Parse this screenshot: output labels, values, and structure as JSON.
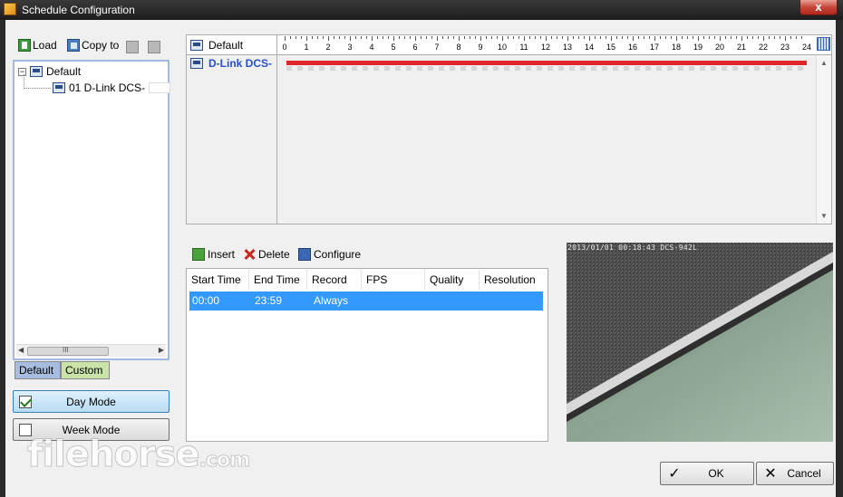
{
  "window": {
    "title": "Schedule Configuration",
    "close_glyph": "x"
  },
  "left_toolbar": {
    "load_label": "Load",
    "copy_label": "Copy to"
  },
  "tree": {
    "root_label": "Default",
    "root_expander": "−",
    "child_label": "01 D-Link DCS-"
  },
  "tree_scroll": {
    "thumb_grip": "III",
    "left_arrow": "◀",
    "right_arrow": "▶"
  },
  "tabs": {
    "default_label": "Default",
    "custom_label": "Custom"
  },
  "modes": {
    "day_label": "Day Mode",
    "day_checked": true,
    "week_label": "Week Mode",
    "week_checked": false
  },
  "timeline": {
    "header_label": "Default",
    "row_label": "D-Link DCS-",
    "hours": [
      "0",
      "1",
      "2",
      "3",
      "4",
      "5",
      "6",
      "7",
      "8",
      "9",
      "10",
      "11",
      "12",
      "13",
      "14",
      "15",
      "16",
      "17",
      "18",
      "19",
      "20",
      "21",
      "22",
      "23",
      "24"
    ],
    "bar_color": "#e0262a",
    "schedule_start_hour": 0,
    "schedule_end_hour": 24,
    "scroll_up": "▲",
    "scroll_down": "▼"
  },
  "list_toolbar": {
    "insert_label": "Insert",
    "delete_label": "Delete",
    "configure_label": "Configure"
  },
  "schedule_list": {
    "columns": [
      "Start Time",
      "End Time",
      "Record",
      "FPS",
      "Quality",
      "Resolution"
    ],
    "rows": [
      {
        "start": "00:00",
        "end": "23:59",
        "record": "Always",
        "fps": "",
        "quality": "",
        "resolution": ""
      }
    ],
    "selected_color": "#3399ff"
  },
  "preview": {
    "timestamp": "2013/01/01 00:18:43 DCS-942L"
  },
  "dialog_buttons": {
    "ok_label": "OK",
    "cancel_label": "Cancel",
    "ok_glyph": "✓",
    "cancel_glyph": "✕"
  },
  "watermark": {
    "brand": "filehorse",
    "suffix": ".com"
  }
}
